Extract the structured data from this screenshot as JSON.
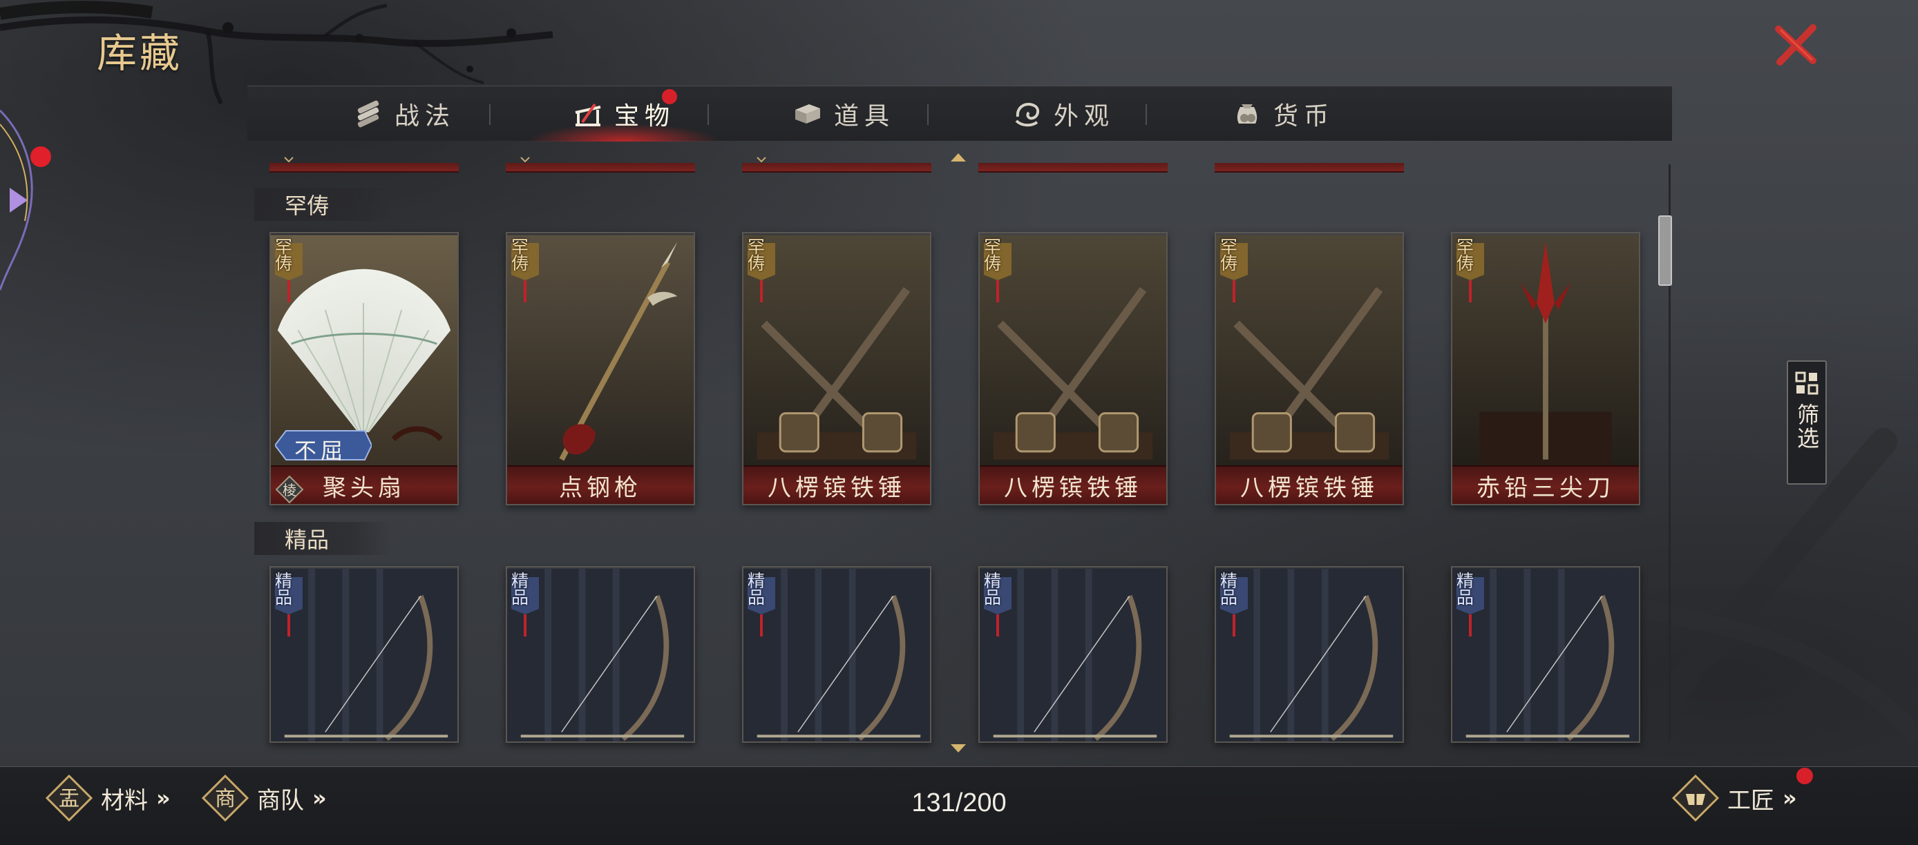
{
  "title": "库藏",
  "tabs": [
    {
      "label": "战法",
      "icon": "scroll-bundle-icon",
      "active": false,
      "dot": false
    },
    {
      "label": "宝物",
      "icon": "weapon-rack-icon",
      "active": true,
      "dot": true
    },
    {
      "label": "道具",
      "icon": "box-icon",
      "active": false,
      "dot": false
    },
    {
      "label": "外观",
      "icon": "swirl-icon",
      "active": false,
      "dot": false
    },
    {
      "label": "货币",
      "icon": "coin-bag-icon",
      "active": false,
      "dot": false
    }
  ],
  "sections": [
    {
      "label": "罕俦",
      "badge": "罕俦",
      "items": [
        {
          "name": "聚头扇",
          "art": "feather-fan",
          "ribbon": "不屈",
          "seal": "棱"
        },
        {
          "name": "点钢枪",
          "art": "spear"
        },
        {
          "name": "八楞镔铁锤",
          "art": "crossed-hammers"
        },
        {
          "name": "八楞镔铁锤",
          "art": "crossed-hammers"
        },
        {
          "name": "八楞镔铁锤",
          "art": "crossed-hammers"
        },
        {
          "name": "赤铅三尖刀",
          "art": "trident-blade"
        }
      ]
    },
    {
      "label": "精品",
      "badge": "精品",
      "items": [
        {
          "art": "bow"
        },
        {
          "art": "bow"
        },
        {
          "art": "bow"
        },
        {
          "art": "bow"
        },
        {
          "art": "bow"
        },
        {
          "art": "bow"
        }
      ]
    }
  ],
  "filter": {
    "label": "筛选"
  },
  "bottom": {
    "materials": "材料",
    "materials_icon_char": "盂",
    "caravan": "商队",
    "caravan_icon_char": "商",
    "workshop": "工匠",
    "chevron": "»",
    "count": "131/200"
  },
  "colors": {
    "accent_red": "#d8202a",
    "gold": "#e7c98f",
    "name_bar": "#6a1f1c"
  }
}
